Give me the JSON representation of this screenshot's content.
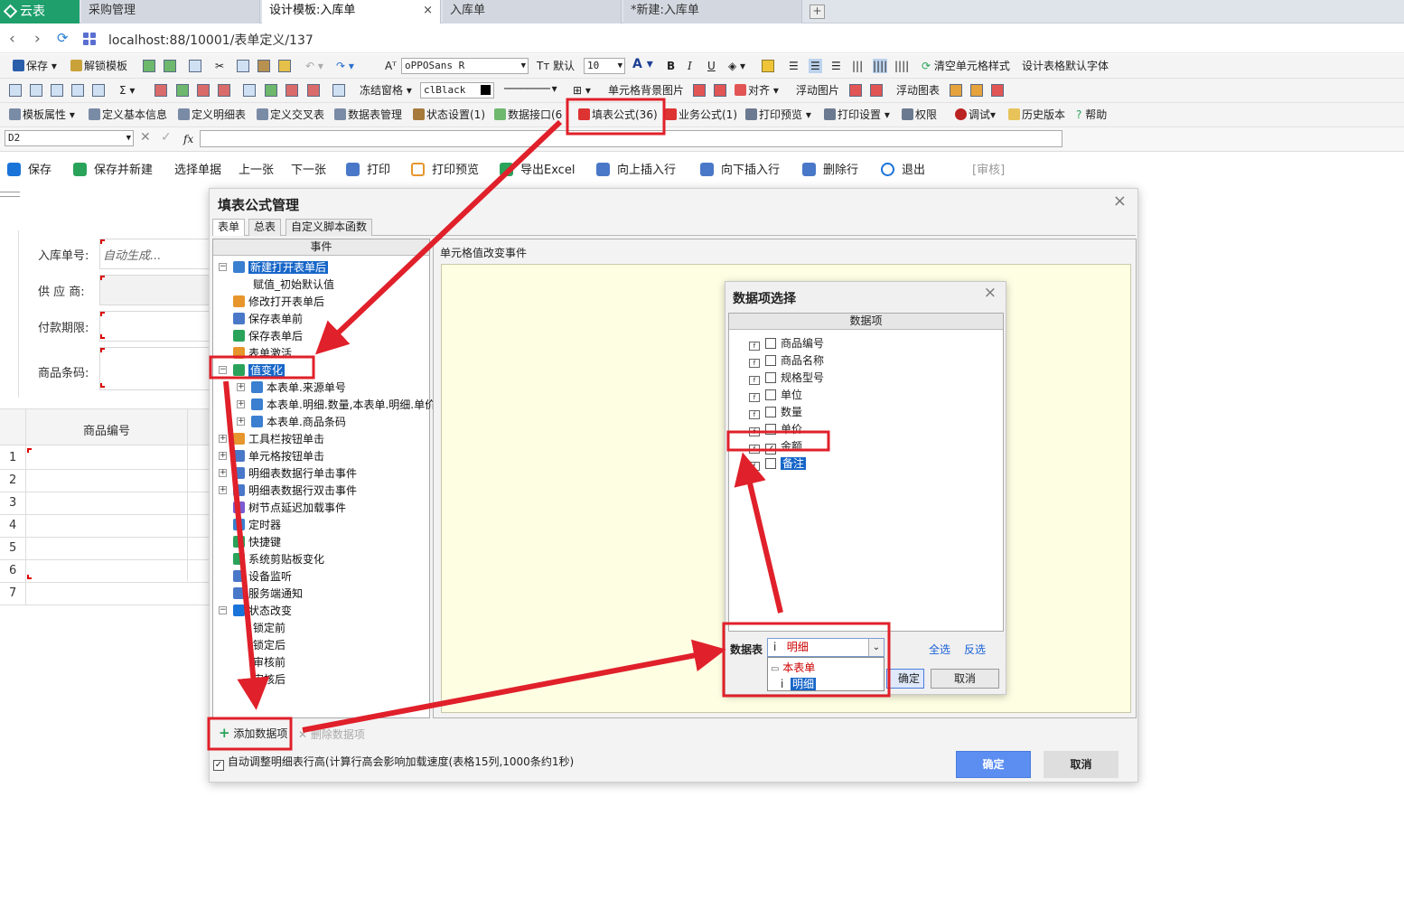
{
  "tabs": {
    "logo": "云表",
    "t1": "采购管理",
    "t2": "设计模板:入库单",
    "t3": "入库单",
    "t4": "*新建:入库单"
  },
  "address": {
    "url": "localhost:88/10001/表单定义/137"
  },
  "toolbar1": {
    "save": "保存",
    "unlock": "解锁模板",
    "font": "oPPOSans R",
    "default": "默认",
    "size": "10",
    "clear": "清空单元格样式",
    "design_font": "设计表格默认字体"
  },
  "toolbar2": {
    "freeze": "冻结窗格",
    "color": "clBlack",
    "bgimg": "单元格背景图片",
    "align": "对齐",
    "float_img": "浮动图片",
    "float_chart": "浮动图表"
  },
  "toolbar3": {
    "tpl_prop": "模板属性",
    "basic": "定义基本信息",
    "detail": "定义明细表",
    "cross": "定义交叉表",
    "datatable": "数据表管理",
    "state": "状态设置(1)",
    "api": "数据接口(6",
    "formula": "填表公式(36)",
    "biz": "业务公式(1)",
    "preview": "打印预览",
    "print_set": "打印设置",
    "perm": "权限",
    "debug": "调试",
    "history": "历史版本",
    "help": "帮助"
  },
  "formula_bar": {
    "cell": "D2"
  },
  "actions": {
    "save": "保存",
    "save_new": "保存并新建",
    "select": "选择单据",
    "prev": "上一张",
    "next": "下一张",
    "print": "打印",
    "print_preview": "打印预览",
    "export": "导出Excel",
    "insert_up": "向上插入行",
    "insert_down": "向下插入行",
    "delete_row": "删除行",
    "exit": "退出",
    "audit": "[审核]"
  },
  "form": {
    "order_no_label": "入库单号:",
    "order_no_value": "自动生成...",
    "supplier_label": "供 应 商:",
    "payterm_label": "付款期限:",
    "barcode_label": "商品条码:",
    "col_header": "商品编号",
    "rows": [
      "1",
      "2",
      "3",
      "4",
      "5",
      "6",
      "7"
    ]
  },
  "dialog": {
    "title": "填表公式管理",
    "tabs": [
      "表单",
      "总表",
      "自定义脚本函数"
    ],
    "events_header": "事件",
    "right_title": "单元格值改变事件",
    "tree": [
      "新建打开表单后",
      "赋值_初始默认值",
      "修改打开表单后",
      "保存表单前",
      "保存表单后",
      "表单激活",
      "值变化",
      "本表单.来源单号",
      "本表单.明细.数量,本表单.明细.单价",
      "本表单.商品条码",
      "工具栏按钮单击",
      "单元格按钮单击",
      "明细表数据行单击事件",
      "明细表数据行双击事件",
      "树节点延迟加载事件",
      "定时器",
      "快捷键",
      "系统剪贴板变化",
      "设备监听",
      "服务端通知",
      "状态改变",
      "锁定前",
      "锁定后",
      "审核前",
      "审核后"
    ],
    "add": "添加数据项",
    "remove": "删除数据项",
    "auto": "自动调整明细表行高(计算行高会影响加载速度(表格15列,1000条约1秒)",
    "ok": "确定",
    "cancel": "取消"
  },
  "sub": {
    "title": "数据项选择",
    "header": "数据项",
    "items": [
      "商品编号",
      "商品名称",
      "规格型号",
      "单位",
      "数量",
      "单价",
      "金额",
      "备注"
    ],
    "table_label": "数据表",
    "table_value": "明细",
    "opt1": "本表单",
    "opt2": "明细",
    "all": "全选",
    "invert": "反选",
    "ok": "确定",
    "cancel": "取消"
  }
}
